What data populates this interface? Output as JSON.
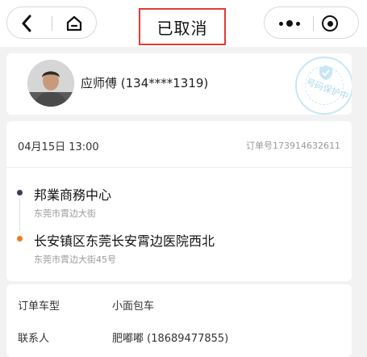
{
  "navbar": {
    "title": "已取消",
    "back_icon": "chevron-left-icon",
    "home_icon": "home-icon",
    "more_icon": "more-dots-icon",
    "close_icon": "target-close-icon"
  },
  "driver": {
    "name_phone": "应师傅 (134****1319)",
    "stamp_text": "号码保护中",
    "avatar_icon": "avatar"
  },
  "order": {
    "datetime": "04月15日 13:00",
    "order_number": "订单号173914632611",
    "origin": {
      "name": "邦業商務中心",
      "address": "东莞市霄边大街",
      "dot_color": "#3a3f58"
    },
    "destination": {
      "name": "长安镇区东莞长安霄边医院西北",
      "address": "东莞市霄边大街45号",
      "dot_color": "#f07a22"
    }
  },
  "info": {
    "rows": [
      {
        "label": "订单车型",
        "value": "小面包车"
      },
      {
        "label": "联系人",
        "value": "肥嘟嘟 (18689477855)"
      }
    ]
  },
  "colors": {
    "highlight_border": "#e53935",
    "stamp": "#9fd3ea"
  }
}
